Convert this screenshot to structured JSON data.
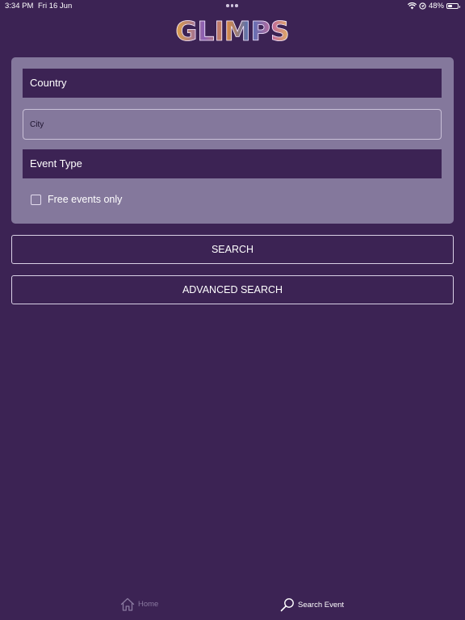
{
  "status_bar": {
    "time": "3:34 PM",
    "date": "Fri 16 Jun",
    "battery_text": "48%",
    "battery_level": 0.48,
    "icons": [
      "wifi-icon",
      "location-icon",
      "battery-icon"
    ]
  },
  "logo": {
    "text": "GLIMPS"
  },
  "form": {
    "country_label": "Country",
    "city_placeholder": "City",
    "city_value": "",
    "event_type_label": "Event Type",
    "free_events_label": "Free events only",
    "free_events_checked": false
  },
  "buttons": {
    "search_label": "SEARCH",
    "advanced_search_label": "ADVANCED SEARCH"
  },
  "tab_bar": {
    "tabs": [
      {
        "label": "Home",
        "icon": "home-icon",
        "active": false
      },
      {
        "label": "Search Event",
        "icon": "search-icon",
        "active": true
      }
    ]
  },
  "colors": {
    "background": "#3c2354",
    "panel": "#84789c",
    "field_dark": "#3c2354",
    "inactive_tab": "#8a7aa0",
    "active_tab": "#ffffff"
  }
}
